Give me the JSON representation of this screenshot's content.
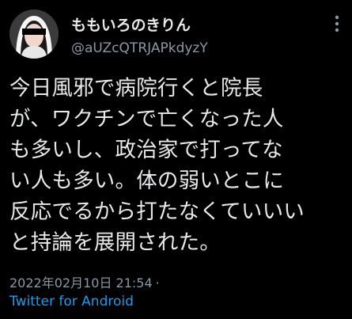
{
  "tweet": {
    "display_name": "ももいろのきりん",
    "handle": "@aUZcQTRJAPkdyzY",
    "text_lines": [
      "今日風邪で病院行くと院長",
      "が、ワクチンで亡くなった人",
      "も多いし、政治家で打ってな",
      "い人も多い。体の弱いとこに",
      "反応でるから打たなくていいい",
      "と持論を展開された。"
    ],
    "timestamp": "2022年02月10日 21:54",
    "separator": "·",
    "source": "Twitter for Android"
  },
  "icons": {
    "avatar": "user-avatar",
    "more": "more-icon"
  },
  "colors": {
    "background": "#000000",
    "text": "#e7e9ea",
    "secondary": "#8b98a5",
    "link": "#1d9bf0"
  }
}
